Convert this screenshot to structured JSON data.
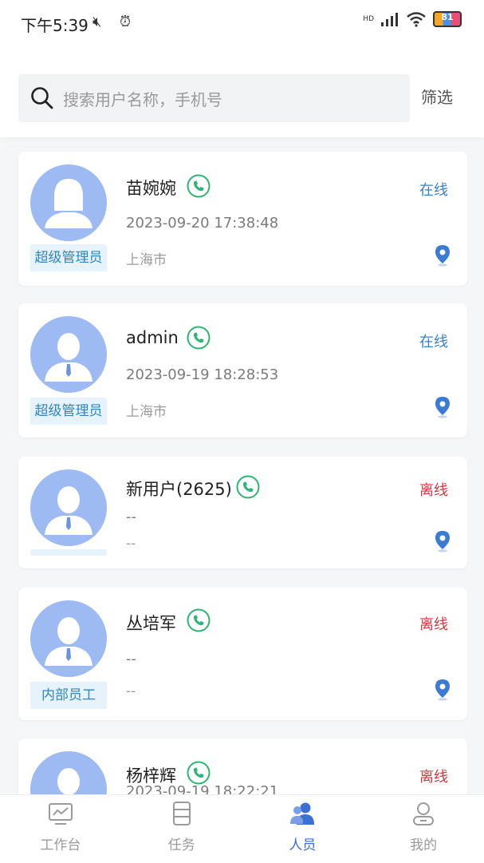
{
  "status_bar": {
    "time": "下午5:39",
    "hd_badge": "HD",
    "battery": "81"
  },
  "search": {
    "placeholder": "搜索用户名称，手机号",
    "filter_label": "筛选"
  },
  "users": [
    {
      "name": "苗婉婉",
      "status": "在线",
      "datetime": "2023-09-20 17:38:48",
      "location": "上海市",
      "role": "超级管理员"
    },
    {
      "name": "admin",
      "status": "在线",
      "datetime": "2023-09-19 18:28:53",
      "location": "上海市",
      "role": "超级管理员"
    },
    {
      "name": "新用户(2625)",
      "status": "离线",
      "datetime": "--",
      "location": "--",
      "role": ""
    },
    {
      "name": "丛培军",
      "status": "离线",
      "datetime": "--",
      "location": "--",
      "role": "内部员工"
    },
    {
      "name": "杨梓辉",
      "status": "离线",
      "datetime": "2023-09-19 18:22:21",
      "location": "",
      "role": ""
    }
  ],
  "tabs": [
    {
      "label": "工作台",
      "icon": "chart-monitor-icon"
    },
    {
      "label": "任务",
      "icon": "document-list-icon"
    },
    {
      "label": "人员",
      "icon": "people-icon"
    },
    {
      "label": "我的",
      "icon": "user-profile-icon"
    }
  ],
  "colors": {
    "online": "#3d7fc4",
    "offline": "#d0373f",
    "accent": "#3b6fd6",
    "phone": "#2bb673",
    "avatar": "#9dbaf3"
  }
}
